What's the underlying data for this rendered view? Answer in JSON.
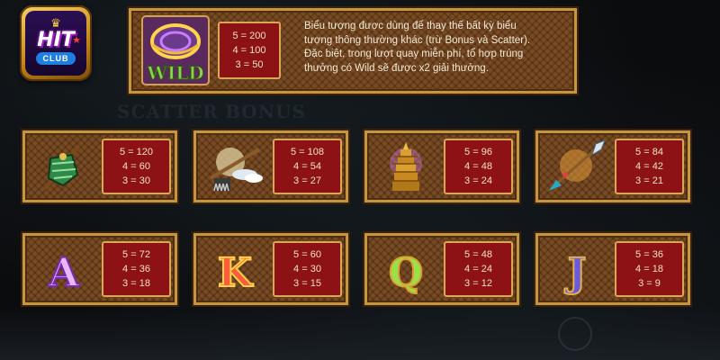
{
  "logo": {
    "text": "HIT",
    "subtext": "CLUB"
  },
  "wild": {
    "label": "WILD",
    "payouts": [
      "5 = 200",
      "4 = 100",
      "3 = 50"
    ],
    "description": [
      "Biểu tượng được dùng để thay thế bất kỳ biểu",
      "tượng thông thường khác (trừ Bonus và Scatter).",
      "Đặc biệt, trong lượt quay miễn phí, tổ hợp trúng",
      "thưởng có Wild sẽ được x2 giải thưởng."
    ]
  },
  "symbols": [
    {
      "icon": "armor-icon",
      "payouts": [
        "5 = 120",
        "4 = 60",
        "3 = 30"
      ]
    },
    {
      "icon": "sword-cloud-icon",
      "payouts": [
        "5 = 108",
        "4 = 54",
        "3 = 27"
      ]
    },
    {
      "icon": "pagoda-icon",
      "payouts": [
        "5 = 96",
        "4 = 48",
        "3 = 24"
      ]
    },
    {
      "icon": "spear-icon",
      "payouts": [
        "5 = 84",
        "4 = 42",
        "3 = 21"
      ]
    },
    {
      "icon": "letter-a-icon",
      "letter": "A",
      "payouts": [
        "5 = 72",
        "4 = 36",
        "3 = 18"
      ]
    },
    {
      "icon": "letter-k-icon",
      "letter": "K",
      "payouts": [
        "5 = 60",
        "4 = 30",
        "3 = 15"
      ]
    },
    {
      "icon": "letter-q-icon",
      "letter": "Q",
      "payouts": [
        "5 = 48",
        "4 = 24",
        "3 = 12"
      ]
    },
    {
      "icon": "letter-j-icon",
      "letter": "J",
      "payouts": [
        "5 = 36",
        "4 = 18",
        "3 = 9"
      ]
    }
  ],
  "colors": {
    "panel": "#7a4a22",
    "border": "#c8953f",
    "paybox": "#8c1216"
  }
}
